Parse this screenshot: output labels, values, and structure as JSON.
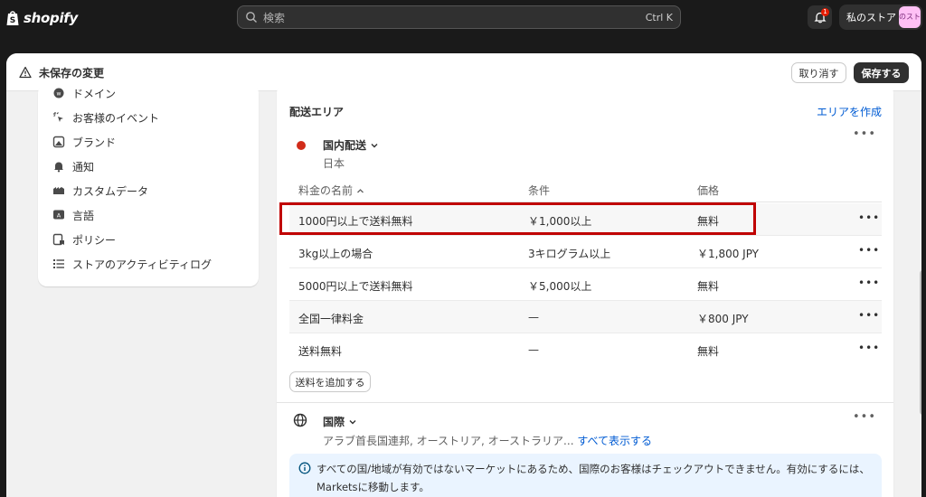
{
  "topbar": {
    "brand": "shopify",
    "search_placeholder": "検索",
    "search_shortcut": "Ctrl K",
    "notification_count": "1",
    "store_name": "私のストア",
    "store_avatar_text": "のスト"
  },
  "contextbar": {
    "title": "未保存の変更",
    "discard_label": "取り消す",
    "save_label": "保存する"
  },
  "sidebar": {
    "items": [
      {
        "label": "ドメイン",
        "icon": "globe-www-icon"
      },
      {
        "label": "お客様のイベント",
        "icon": "sparkle-cursor-icon"
      },
      {
        "label": "ブランド",
        "icon": "brand-icon"
      },
      {
        "label": "通知",
        "icon": "bell-icon"
      },
      {
        "label": "カスタムデータ",
        "icon": "data-icon"
      },
      {
        "label": "言語",
        "icon": "language-icon"
      },
      {
        "label": "ポリシー",
        "icon": "policy-icon"
      },
      {
        "label": "ストアのアクティビティログ",
        "icon": "list-icon"
      }
    ]
  },
  "shipping": {
    "section_title": "配送エリア",
    "create_zone_label": "エリアを作成",
    "domestic": {
      "name": "国内配送",
      "countries": "日本"
    },
    "columns": {
      "name": "料金の名前",
      "condition": "条件",
      "price": "価格"
    },
    "rates": [
      {
        "name": "1000円以上で送料無料",
        "condition": "￥1,000以上",
        "price": "無料"
      },
      {
        "name": "3kg以上の場合",
        "condition": "3キログラム以上",
        "price": "￥1,800 JPY"
      },
      {
        "name": "5000円以上で送料無料",
        "condition": "￥5,000以上",
        "price": "無料"
      },
      {
        "name": "全国一律料金",
        "condition": "—",
        "price": "￥800 JPY"
      },
      {
        "name": "送料無料",
        "condition": "—",
        "price": "無料"
      }
    ],
    "add_rate_label": "送料を追加する",
    "international": {
      "name": "国際",
      "countries": "アラブ首長国連邦, オーストリア, オーストラリア...",
      "show_all_label": "すべて表示する"
    },
    "banner_text": "すべての国/地域が有効ではないマーケットにあるため、国際のお客様はチェックアウトできません。有効にするには、Marketsに移動します。"
  },
  "colors": {
    "brand_dark": "#1a1a1a",
    "link": "#005bd3",
    "highlight": "#c00000",
    "zone_dot": "#d12c1a",
    "badge": "#e51c00"
  }
}
